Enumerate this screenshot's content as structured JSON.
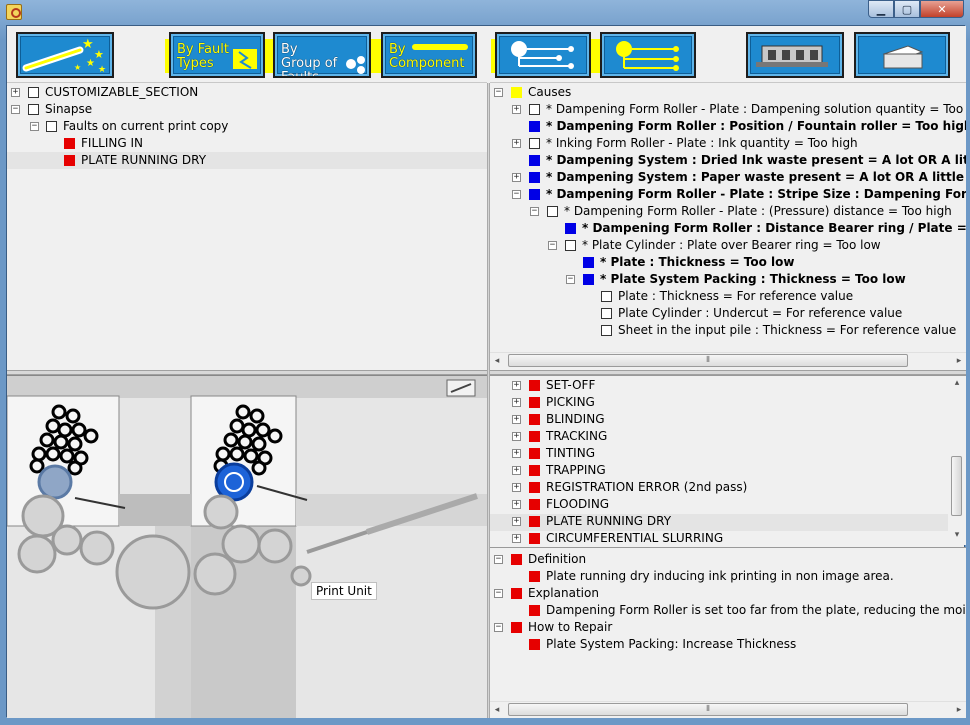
{
  "window": {
    "title": ""
  },
  "left_toolbar": {
    "buttons": [
      {
        "name": "wand-button",
        "label": ""
      },
      {
        "name": "by-fault-types-button",
        "label": "By Fault Types"
      },
      {
        "name": "by-group-of-faults-button",
        "label": "By Group of Faults"
      },
      {
        "name": "by-component-button",
        "label": "By Component"
      }
    ]
  },
  "left_tree": [
    {
      "label": "CUSTOMIZABLE_SECTION"
    },
    {
      "label": "Sinapse"
    },
    {
      "label": "Faults on current print copy"
    },
    {
      "label": "FILLING IN"
    },
    {
      "label": "PLATE RUNNING DRY"
    }
  ],
  "diagram": {
    "label": "Print Unit"
  },
  "causes_tree": [
    {
      "label": "Causes"
    },
    {
      "label": "* Dampening Form Roller - Plate :  Dampening solution quantity = Too low"
    },
    {
      "label": "* Dampening Form Roller :  Position / Fountain roller = Too high"
    },
    {
      "label": "* Inking Form Roller - Plate :  Ink quantity = Too high"
    },
    {
      "label": "* Dampening System :  Dried Ink waste present = A lot OR A little OR Enormously"
    },
    {
      "label": "* Dampening System :  Paper waste present = A lot OR A little OR Enormously"
    },
    {
      "label": "* Dampening Form Roller - Plate :  Stripe Size : Dampening Form roller / Plate = Too"
    },
    {
      "label": "* Dampening Form Roller - Plate :  (Pressure) distance = Too high"
    },
    {
      "label": "* Dampening Form Roller :  Distance Bearer ring / Plate = Too high"
    },
    {
      "label": "* Plate Cylinder :  Plate over Bearer ring = Too low"
    },
    {
      "label": "* Plate :  Thickness = Too low"
    },
    {
      "label": "* Plate System Packing :  Thickness = Too low"
    },
    {
      "label": "Plate :  Thickness =  For reference value"
    },
    {
      "label": "Plate Cylinder :  Undercut =  For reference value"
    },
    {
      "label": "Sheet in the input pile :  Thickness =  For reference value"
    }
  ],
  "faults_list": [
    {
      "label": "SET-OFF"
    },
    {
      "label": "PICKING"
    },
    {
      "label": "BLINDING"
    },
    {
      "label": "TRACKING"
    },
    {
      "label": "TINTING"
    },
    {
      "label": "TRAPPING"
    },
    {
      "label": "REGISTRATION ERROR (2nd pass)"
    },
    {
      "label": "FLOODING"
    },
    {
      "label": "PLATE RUNNING DRY"
    },
    {
      "label": "CIRCUMFERENTIAL SLURRING"
    }
  ],
  "details": [
    {
      "label": "Definition"
    },
    {
      "label": "Plate running dry inducing ink printing in non image area."
    },
    {
      "label": "Explanation"
    },
    {
      "label": "Dampening Form Roller is set too far from the plate, reducing the moisture quantity"
    },
    {
      "label": "How to Repair"
    },
    {
      "label": "Plate System Packing: Increase Thickness"
    }
  ],
  "colors": {
    "red": "#e60000",
    "blue": "#0000e6",
    "yellow": "#ffff00",
    "button_blue": "#1e8ad0"
  }
}
